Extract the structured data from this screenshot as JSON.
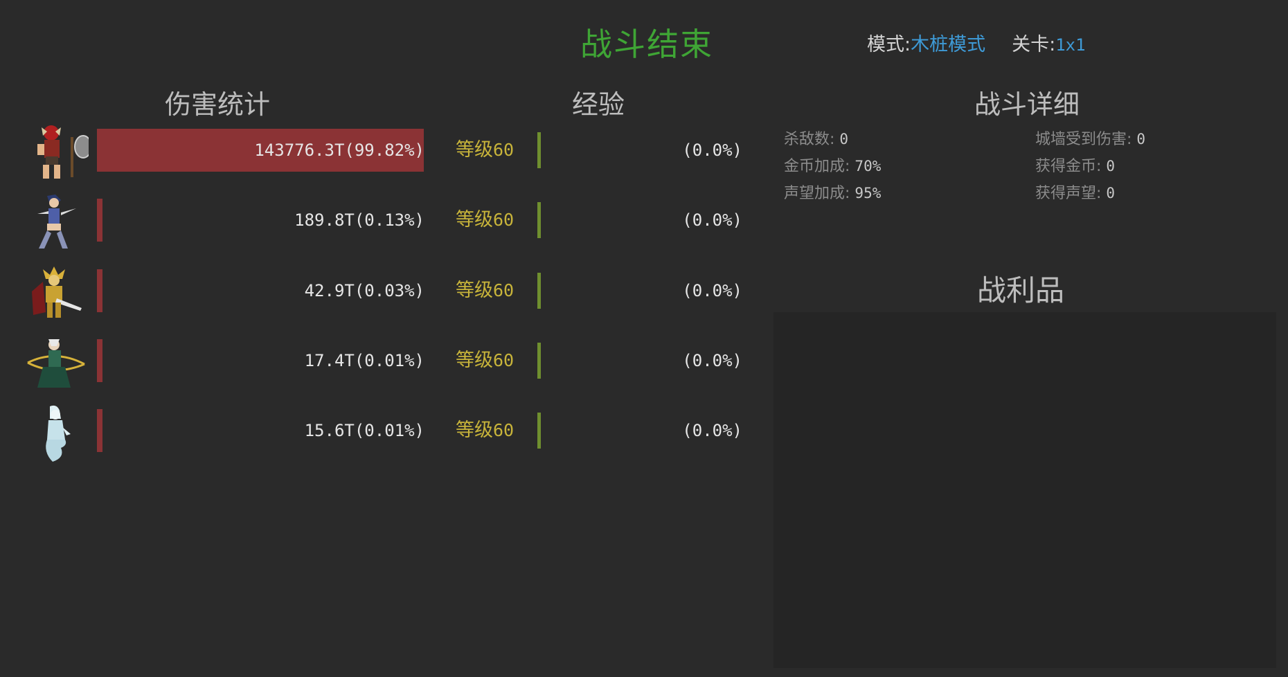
{
  "header": {
    "title": "战斗结束",
    "mode_label": "模式:",
    "mode_value": "木桩模式",
    "stage_label": "关卡:",
    "stage_value": "1x1"
  },
  "sections": {
    "damage": "伤害统计",
    "exp": "经验",
    "details": "战斗详细",
    "loot": "战利品"
  },
  "colors": {
    "title": "#3fa535",
    "accent_blue": "#3e9ad6",
    "damage_bar": "#8b3335",
    "level_text": "#c8b43a",
    "exp_bar": "#6f8f2f"
  },
  "heroes": [
    {
      "portrait": "axe-warrior-portrait-icon",
      "damage": "143776.3T(99.82%)",
      "damage_share": 0.9982,
      "level_label": "等级",
      "level": "60",
      "exp": "(0.0%)",
      "exp_progress": 0.0
    },
    {
      "portrait": "dual-blade-heroine-portrait-icon",
      "damage": "189.8T(0.13%)",
      "damage_share": 0.0013,
      "level_label": "等级",
      "level": "60",
      "exp": "(0.0%)",
      "exp_progress": 0.0
    },
    {
      "portrait": "golden-knight-portrait-icon",
      "damage": "42.9T(0.03%)",
      "damage_share": 0.0003,
      "level_label": "等级",
      "level": "60",
      "exp": "(0.0%)",
      "exp_progress": 0.0
    },
    {
      "portrait": "elf-archer-portrait-icon",
      "damage": "17.4T(0.01%)",
      "damage_share": 0.0001,
      "level_label": "等级",
      "level": "60",
      "exp": "(0.0%)",
      "exp_progress": 0.0
    },
    {
      "portrait": "ice-spirit-portrait-icon",
      "damage": "15.6T(0.01%)",
      "damage_share": 0.0001,
      "level_label": "等级",
      "level": "60",
      "exp": "(0.0%)",
      "exp_progress": 0.0
    }
  ],
  "details": {
    "kills_label": "杀敌数:",
    "kills": "0",
    "wall_damage_label": "城墙受到伤害:",
    "wall_damage": "0",
    "gold_bonus_label": "金币加成:",
    "gold_bonus": "70%",
    "gold_gained_label": "获得金币:",
    "gold_gained": "0",
    "fame_bonus_label": "声望加成:",
    "fame_bonus": "95%",
    "fame_gained_label": "获得声望:",
    "fame_gained": "0"
  }
}
